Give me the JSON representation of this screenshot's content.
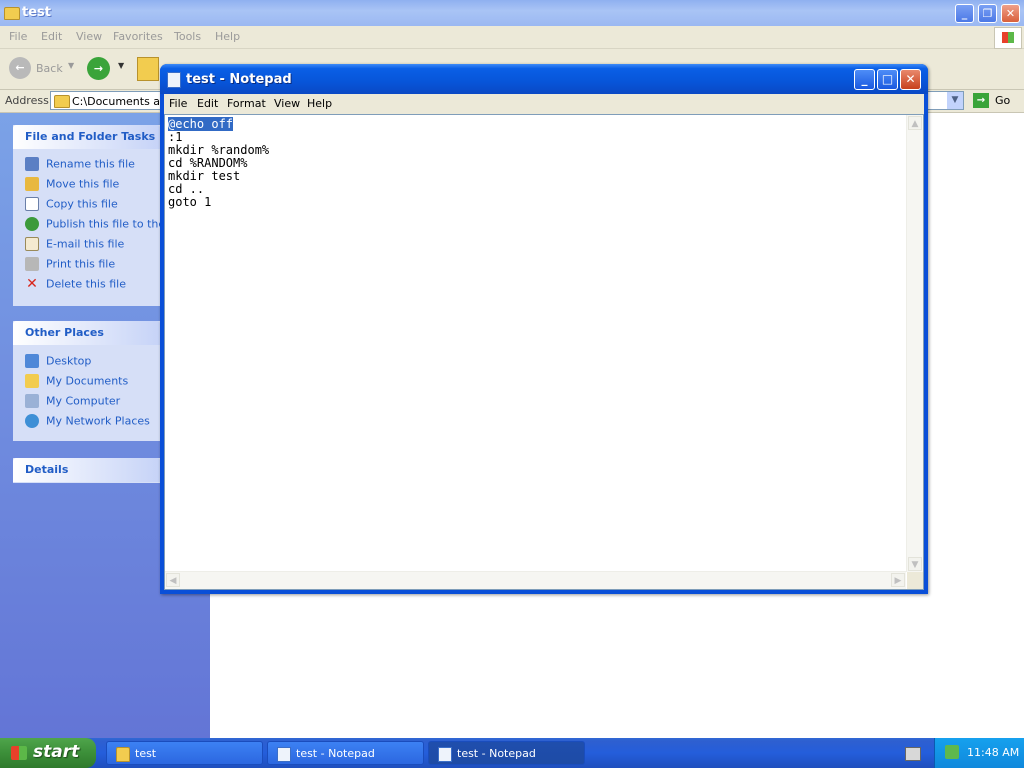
{
  "explorer": {
    "title": "test",
    "menu": [
      "File",
      "Edit",
      "View",
      "Favorites",
      "Tools",
      "Help"
    ],
    "toolbar": {
      "back_label": "Back"
    },
    "address": {
      "label": "Address",
      "value": "C:\\Documents and",
      "go_label": "Go"
    },
    "file_tasks": {
      "title": "File and Folder Tasks",
      "items": [
        {
          "label": "Rename this file",
          "icon": "rename-icon"
        },
        {
          "label": "Move this file",
          "icon": "move-icon"
        },
        {
          "label": "Copy this file",
          "icon": "copy-icon"
        },
        {
          "label": "Publish this file to the W",
          "icon": "publish-icon"
        },
        {
          "label": "E-mail this file",
          "icon": "email-icon"
        },
        {
          "label": "Print this file",
          "icon": "print-icon"
        },
        {
          "label": "Delete this file",
          "icon": "delete-icon"
        }
      ]
    },
    "other_places": {
      "title": "Other Places",
      "items": [
        {
          "label": "Desktop",
          "icon": "desktop-icon"
        },
        {
          "label": "My Documents",
          "icon": "my-documents-icon"
        },
        {
          "label": "My Computer",
          "icon": "my-computer-icon"
        },
        {
          "label": "My Network Places",
          "icon": "network-places-icon"
        }
      ]
    },
    "details": {
      "title": "Details"
    }
  },
  "notepad": {
    "title": "test - Notepad",
    "menu": [
      "File",
      "Edit",
      "Format",
      "View",
      "Help"
    ],
    "lines": {
      "l1_selected": "@echo off",
      "rest": ":1\nmkdir %random%\ncd %RANDOM%\nmkdir test\ncd ..\ngoto 1"
    }
  },
  "taskbar": {
    "start_label": "start",
    "buttons": [
      "test",
      "test - Notepad",
      "test - Notepad"
    ],
    "clock": "11:48 AM"
  },
  "colors": {
    "xp_blue": "#0a5fe6",
    "side_link": "#215dc6",
    "start_green": "#3c8f39",
    "selection": "#316ac5"
  }
}
